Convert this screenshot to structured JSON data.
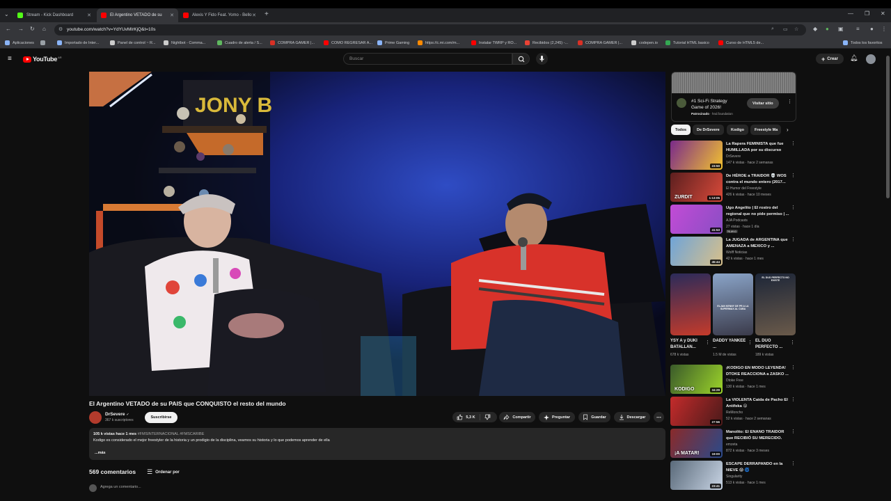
{
  "browser": {
    "tabs": [
      {
        "label": "Stream - Kick Dashboard",
        "fav": "#53fc18"
      },
      {
        "label": "El Argentino VETADO de su",
        "fav": "#ff0000"
      },
      {
        "label": "Alexis Y Fido Feat. Yomo - Bello",
        "fav": "#ff0000"
      }
    ],
    "url": "youtube.com/watch?v=YdYUvMIrKjQ&t=10s",
    "bookmarks": [
      {
        "label": "Aplicaciones",
        "color": "#8ab4f8"
      },
      {
        "label": "Importado de Inter...",
        "color": "#8ab4f8"
      },
      {
        "label": "Panel de control ~ R...",
        "color": "#cccccc"
      },
      {
        "label": "Nightbot - Comma...",
        "color": "#cccccc"
      },
      {
        "label": "Cuadro de alerta / S...",
        "color": "#5fb85f"
      },
      {
        "label": "COMPRA GAMER |...",
        "color": "#d93025"
      },
      {
        "label": "COMO REGRESAR A...",
        "color": "#ff0000"
      },
      {
        "label": "Prime Gaming",
        "color": "#8ab4f8"
      },
      {
        "label": "https://c.mi.com/m...",
        "color": "#ff8a00"
      },
      {
        "label": "Instalar TWRP y RO...",
        "color": "#ff0000"
      },
      {
        "label": "Recibidos (2,245) -...",
        "color": "#ea4335"
      },
      {
        "label": "COMPRA GAMER |...",
        "color": "#d93025"
      },
      {
        "label": "codepen.io",
        "color": "#cccccc"
      },
      {
        "label": "Tutorial HTML basico",
        "color": "#34a853"
      },
      {
        "label": "Curso de HTML5 de...",
        "color": "#ff0000"
      },
      {
        "label": "Todos los favoritos",
        "color": "#8ab4f8"
      }
    ]
  },
  "header": {
    "logo": "YouTube",
    "country": "AR",
    "search_placeholder": "Buscar",
    "create_label": "Crear"
  },
  "video": {
    "title": "El Argentino VETADO de su PAIS que CONQUISTO el resto del mundo",
    "banner_text": "JONY B",
    "channel": "DrSevere",
    "subscribers": "367 k suscriptores",
    "subscribe_label": "Suscribirse",
    "likes": "5,3 K",
    "share_label": "Compartir",
    "ask_label": "Preguntar",
    "save_label": "Guardar",
    "download_label": "Descargar",
    "tooltip": "Descargar",
    "desc_stats": "105 k vistas  hace 1 mes",
    "desc_tags": "#FMSINTERNACIONAL #FMSCARIBE",
    "desc_text": "Kodigo es considerado el mejor freestyler de la historia y un prodigio de la disciplina, veamos su historia y lo que podemos aprender de ella",
    "desc_more": "...más",
    "comments_count": "569 comentarios",
    "sort_label": "Ordenar por",
    "comment_placeholder": "Agrega un comentario..."
  },
  "sidebar": {
    "ad": {
      "title": "#1 Sci-Fi Strategy Game of 2026!",
      "sponsored": "Patrocinado",
      "domain": "hnd.foundation",
      "button": "Visitar sitio"
    },
    "chips": [
      "Todos",
      "De DrSevere",
      "Kodigo",
      "Freestyle Ma"
    ],
    "recs_top": [
      {
        "title": "La Rapera FEMINISTA que fue HUMILLADA por su discurso",
        "channel": "DrSevere",
        "meta": "147 k vistas · hace 2 semanas",
        "duration": "23:50",
        "colors": [
          "#7a2a8a",
          "#f2c230"
        ]
      },
      {
        "title": "De HÉROE a TRAIDOR 💀 WOS contra el mundo entero (2017...",
        "channel": "El Humor del Freestyle",
        "meta": "426 k vistas · hace 10 meses",
        "duration": "1:13:05",
        "badge": "ZURDIT",
        "colors": [
          "#5c1f1f",
          "#d94a3a"
        ]
      },
      {
        "title": "Ugo Angelito | El rostro del regional que no pide permiso | ...",
        "channel": "AJA Podcasts",
        "meta": "27 vistas · hace 1 día",
        "extra": "Nuevo",
        "duration": "41:53",
        "colors": [
          "#c24bd6",
          "#8a4ec4"
        ]
      },
      {
        "title": "La JUGADA de ARGENTINA que AMENAZA a MEXICO y ...",
        "channel": "Wolff Noticias",
        "meta": "42 k vistas · hace 1 mes",
        "duration": "45:44",
        "colors": [
          "#6fa4d8",
          "#d8c08a"
        ]
      }
    ],
    "shorts": [
      {
        "title": "YSY A y DUKI BATALLAN...",
        "views": "678 k vistas",
        "colors": [
          "#2b2b5a",
          "#c43b2b"
        ]
      },
      {
        "title": "DADDY YANKEE ...",
        "views": "1.5 M de vistas",
        "caption": "ELJAN KENNY DE PR A LA SUPERMAX AL CUBA",
        "colors": [
          "#8aa4c8",
          "#3a3a4a"
        ]
      },
      {
        "title": "EL DUO PERFECTO ...",
        "views": "189 k vistas",
        "caption": "EL DUO PERFECTO NO EXISTE",
        "colors": [
          "#1d2638",
          "#6a5a4a"
        ]
      }
    ],
    "recs_bottom": [
      {
        "title": "¡KODIGO EN MODO LEYENDA! DTOKE REACCIONA a ZASKO ...",
        "channel": "Dtoke Free",
        "meta": "130 k vistas · hace 1 mes",
        "duration": "34:29",
        "badge": "KODIGO",
        "colors": [
          "#3a5a2a",
          "#9cd42a"
        ]
      },
      {
        "title": "La VIOLENTA Caida de Pacho El Antifeka 😮",
        "channel": "ReMoncho",
        "meta": "52 k vistas · hace 2 semanas",
        "duration": "27:56",
        "colors": [
          "#c42b2b",
          "#4a1a1a"
        ]
      },
      {
        "title": "Manolito: El ENANO TRAIDOR que RECIBIÓ SU MERECIDO.",
        "channel": "emzeta",
        "meta": "872 k vistas · hace 3 meses",
        "duration": "19:00",
        "badge": "¡A MATAR!",
        "colors": [
          "#8a2a2a",
          "#2a4a8a"
        ]
      },
      {
        "title": "ESCAPE DERRAPANDO en la NIEVE 😱 🌀",
        "channel": "Singularity",
        "meta": "513 k vistas · hace 1 mes",
        "duration": "23:41",
        "colors": [
          "#5a6a7a",
          "#c8d4e4"
        ]
      }
    ]
  }
}
